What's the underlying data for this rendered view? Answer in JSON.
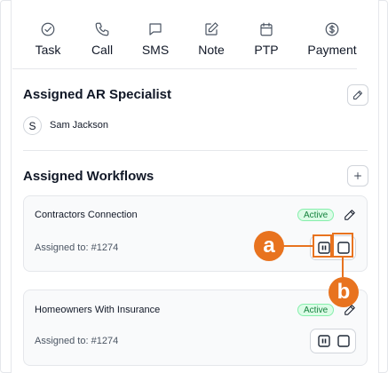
{
  "actions": [
    {
      "label": "Task",
      "icon": "check-circle-icon"
    },
    {
      "label": "Call",
      "icon": "phone-icon"
    },
    {
      "label": "SMS",
      "icon": "message-icon"
    },
    {
      "label": "Note",
      "icon": "edit-note-icon"
    },
    {
      "label": "PTP",
      "icon": "calendar-icon"
    },
    {
      "label": "Payment",
      "icon": "dollar-circle-icon"
    }
  ],
  "specialist": {
    "title": "Assigned AR Specialist",
    "avatar_initial": "S",
    "name": "Sam Jackson"
  },
  "workflows": {
    "title": "Assigned Workflows",
    "items": [
      {
        "name": "Contractors Connection",
        "status": "Active",
        "assigned": "Assigned to: #1274"
      },
      {
        "name": "Homeowners With Insurance",
        "status": "Active",
        "assigned": "Assigned to: #1274"
      }
    ]
  },
  "callouts": {
    "a": "a",
    "b": "b",
    "color": "#e8731f"
  },
  "colors": {
    "active_badge_bg": "#dcfce7",
    "active_badge_text": "#15803d",
    "accent": "#e8731f"
  }
}
